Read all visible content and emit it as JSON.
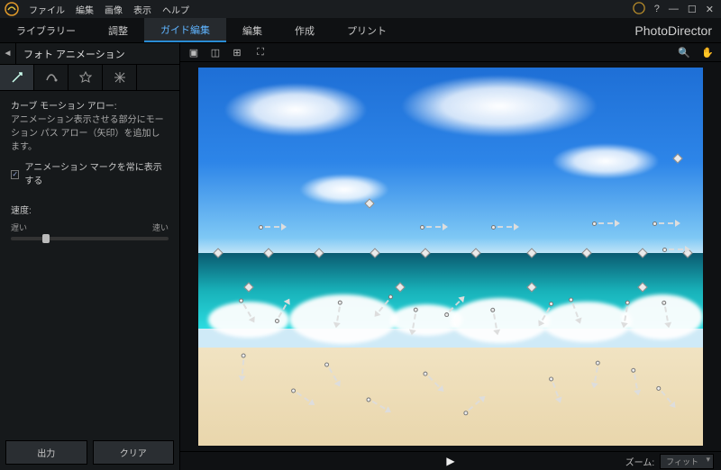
{
  "menu": {
    "file": "ファイル",
    "edit": "編集",
    "image": "画像",
    "view": "表示",
    "help": "ヘルプ"
  },
  "brand": "PhotoDirector",
  "tabs": {
    "library": "ライブラリー",
    "adjust": "調整",
    "guided": "ガイド編集",
    "editHeader": "編集",
    "create": "作成",
    "print": "プリント"
  },
  "panel": {
    "title": "フォト アニメーション",
    "h": "カーブ モーション アロー:",
    "d": "アニメーション表示させる部分にモーション パス アロー（矢印）を追加します。",
    "chk": "アニメーション マークを常に表示する",
    "speed": "速度:",
    "slow": "遅い",
    "fast": "速い",
    "output": "出力",
    "clear": "クリア"
  },
  "zoom": {
    "label": "ズーム:",
    "value": "フィット"
  }
}
